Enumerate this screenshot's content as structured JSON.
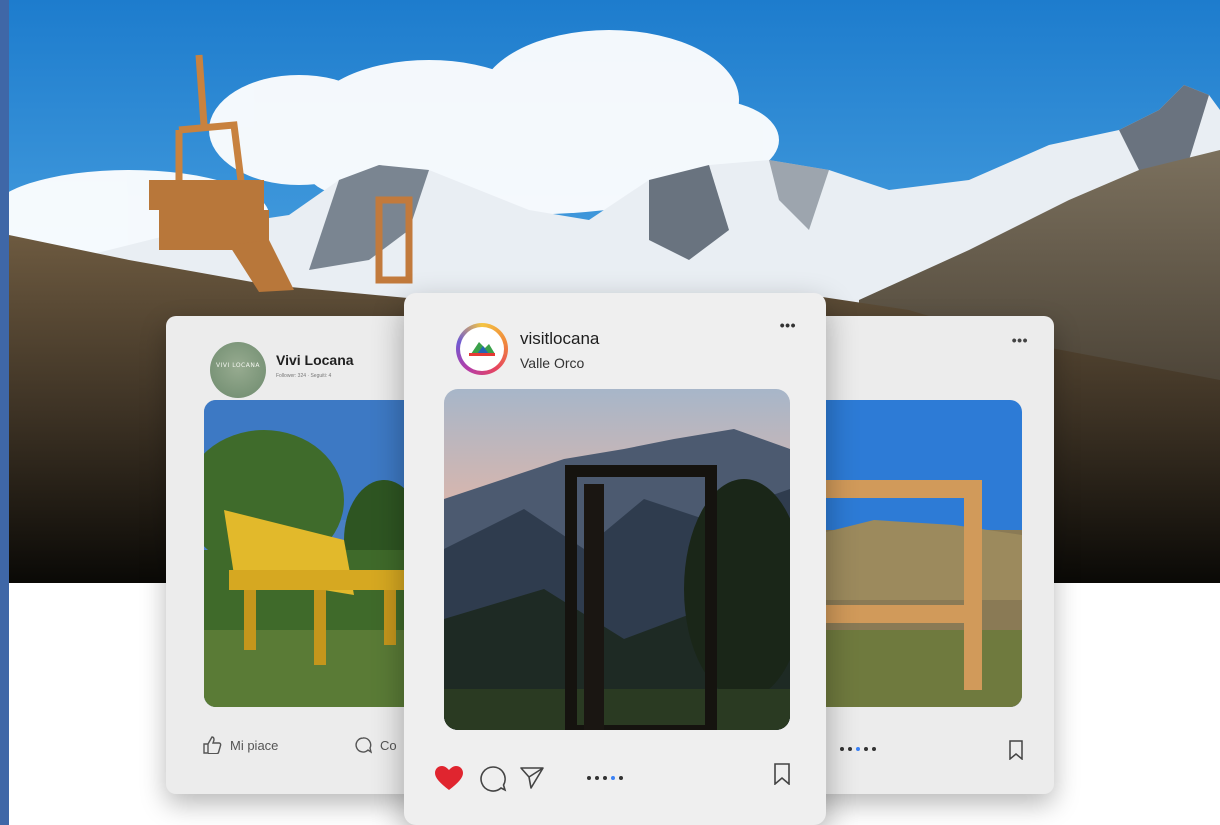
{
  "cards": {
    "left": {
      "page_name": "Vivi Locana",
      "page_meta": "Follower: 324 · Seguiti: 4",
      "avatar_text": "VIVI LOCANA",
      "like_label": "Mi piace",
      "comment_label": "Co"
    },
    "center": {
      "username": "visitlocana",
      "location": "Valle Orco",
      "more": "•••",
      "liked": true,
      "carousel_dots": 5,
      "active_dot": 4
    },
    "right": {
      "more": "•••",
      "carousel_dots": 5,
      "active_dot": 3
    }
  },
  "colors": {
    "accent_strip": "#3f67a7",
    "heart": "#e0252f",
    "active_dot": "#3b82f6"
  }
}
